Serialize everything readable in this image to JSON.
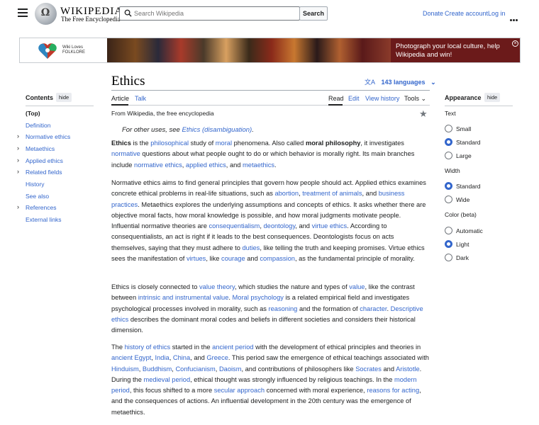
{
  "header": {
    "wordmark": "WIKIPEDIA",
    "tagline": "The Free Encyclopedia",
    "search_placeholder": "Search Wikipedia",
    "search_button": "Search",
    "donate": "Donate",
    "create_account": "Create account",
    "log_in": "Log in"
  },
  "banner": {
    "logo_line1": "Wiki Loves",
    "logo_line2": "FOLKLORE",
    "text": "Photograph your local culture, help Wikipedia and win!"
  },
  "article": {
    "title": "Ethics",
    "languages": "143 languages",
    "tabs": {
      "article": "Article",
      "talk": "Talk",
      "read": "Read",
      "edit": "Edit",
      "history": "View history",
      "tools": "Tools"
    },
    "from": "From Wikipedia, the free encyclopedia",
    "hatnote_prefix": "For other uses, see ",
    "hatnote_link": "Ethics (disambiguation)",
    "hatnote_suffix": "."
  },
  "toc": {
    "title": "Contents",
    "hide": "hide",
    "items": [
      {
        "label": "(Top)",
        "expandable": false
      },
      {
        "label": "Definition",
        "expandable": false
      },
      {
        "label": "Normative ethics",
        "expandable": true
      },
      {
        "label": "Metaethics",
        "expandable": true
      },
      {
        "label": "Applied ethics",
        "expandable": true
      },
      {
        "label": "Related fields",
        "expandable": true
      },
      {
        "label": "History",
        "expandable": false
      },
      {
        "label": "See also",
        "expandable": false
      },
      {
        "label": "References",
        "expandable": true
      },
      {
        "label": "External links",
        "expandable": false
      }
    ]
  },
  "appearance": {
    "title": "Appearance",
    "hide": "hide",
    "text_label": "Text",
    "text_options": [
      "Small",
      "Standard",
      "Large"
    ],
    "text_selected": "Standard",
    "width_label": "Width",
    "width_options": [
      "Standard",
      "Wide"
    ],
    "width_selected": "Standard",
    "color_label": "Color (beta)",
    "color_options": [
      "Automatic",
      "Light",
      "Dark"
    ],
    "color_selected": "Light"
  },
  "paragraphs": [
    [
      {
        "t": "Ethics",
        "b": true
      },
      {
        "t": " is the "
      },
      {
        "t": "philosophical",
        "l": true
      },
      {
        "t": " study of "
      },
      {
        "t": "moral",
        "l": true
      },
      {
        "t": " phenomena. Also called "
      },
      {
        "t": "moral philosophy",
        "b": true
      },
      {
        "t": ", it investigates "
      },
      {
        "t": "normative",
        "l": true
      },
      {
        "t": " questions about what people ought to do or which behavior is morally right. Its main branches include "
      },
      {
        "t": "normative ethics",
        "l": true
      },
      {
        "t": ", "
      },
      {
        "t": "applied ethics",
        "l": true
      },
      {
        "t": ", and "
      },
      {
        "t": "metaethics",
        "l": true
      },
      {
        "t": "."
      }
    ],
    [
      {
        "t": "Normative ethics aims to find general principles that govern how people should act. Applied ethics examines concrete ethical problems in real-life situations, such as "
      },
      {
        "t": "abortion",
        "l": true
      },
      {
        "t": ", "
      },
      {
        "t": "treatment of animals",
        "l": true
      },
      {
        "t": ", and "
      },
      {
        "t": "business practices",
        "l": true
      },
      {
        "t": ". Metaethics explores the underlying assumptions and concepts of ethics. It asks whether there are objective moral facts, how moral knowledge is possible, and how moral judgments motivate people. Influential normative theories are "
      },
      {
        "t": "consequentialism",
        "l": true
      },
      {
        "t": ", "
      },
      {
        "t": "deontology",
        "l": true
      },
      {
        "t": ", and "
      },
      {
        "t": "virtue ethics",
        "l": true
      },
      {
        "t": ". According to consequentialists, an act is right if it leads to the best consequences. Deontologists focus on acts themselves, saying that they must adhere to "
      },
      {
        "t": "duties",
        "l": true
      },
      {
        "t": ", like telling the truth and keeping promises. Virtue ethics sees the manifestation of "
      },
      {
        "t": "virtues",
        "l": true
      },
      {
        "t": ", like "
      },
      {
        "t": "courage",
        "l": true
      },
      {
        "t": " and "
      },
      {
        "t": "compassion",
        "l": true
      },
      {
        "t": ", as the fundamental principle of morality."
      }
    ],
    [
      {
        "t": "Ethics is closely connected to "
      },
      {
        "t": "value theory",
        "l": true
      },
      {
        "t": ", which studies the nature and types of "
      },
      {
        "t": "value",
        "l": true
      },
      {
        "t": ", like the contrast between "
      },
      {
        "t": "intrinsic and instrumental value",
        "l": true
      },
      {
        "t": ". "
      },
      {
        "t": "Moral psychology",
        "l": true
      },
      {
        "t": " is a related empirical field and investigates psychological processes involved in morality, such as "
      },
      {
        "t": "reasoning",
        "l": true
      },
      {
        "t": " and the formation of "
      },
      {
        "t": "character",
        "l": true
      },
      {
        "t": ". "
      },
      {
        "t": "Descriptive ethics",
        "l": true
      },
      {
        "t": " describes the dominant moral codes and beliefs in different societies and considers their historical dimension."
      }
    ],
    [
      {
        "t": "The "
      },
      {
        "t": "history of ethics",
        "l": true
      },
      {
        "t": " started in the "
      },
      {
        "t": "ancient period",
        "l": true
      },
      {
        "t": " with the development of ethical principles and theories in "
      },
      {
        "t": "ancient Egypt",
        "l": true
      },
      {
        "t": ", "
      },
      {
        "t": "India",
        "l": true
      },
      {
        "t": ", "
      },
      {
        "t": "China",
        "l": true
      },
      {
        "t": ", and "
      },
      {
        "t": "Greece",
        "l": true
      },
      {
        "t": ". This period saw the emergence of ethical teachings associated with "
      },
      {
        "t": "Hinduism",
        "l": true
      },
      {
        "t": ", "
      },
      {
        "t": "Buddhism",
        "l": true
      },
      {
        "t": ", "
      },
      {
        "t": "Confucianism",
        "l": true
      },
      {
        "t": ", "
      },
      {
        "t": "Daoism",
        "l": true
      },
      {
        "t": ", and contributions of philosophers like "
      },
      {
        "t": "Socrates",
        "l": true
      },
      {
        "t": " and "
      },
      {
        "t": "Aristotle",
        "l": true
      },
      {
        "t": ". During the "
      },
      {
        "t": "medieval period",
        "l": true
      },
      {
        "t": ", ethical thought was strongly influenced by religious teachings. In the "
      },
      {
        "t": "modern period",
        "l": true
      },
      {
        "t": ", this focus shifted to a more "
      },
      {
        "t": "secular approach",
        "l": true
      },
      {
        "t": " concerned with moral experience, "
      },
      {
        "t": "reasons for acting",
        "l": true
      },
      {
        "t": ", and the consequences of actions. An influential development in the 20th century was the emergence of metaethics."
      }
    ]
  ]
}
